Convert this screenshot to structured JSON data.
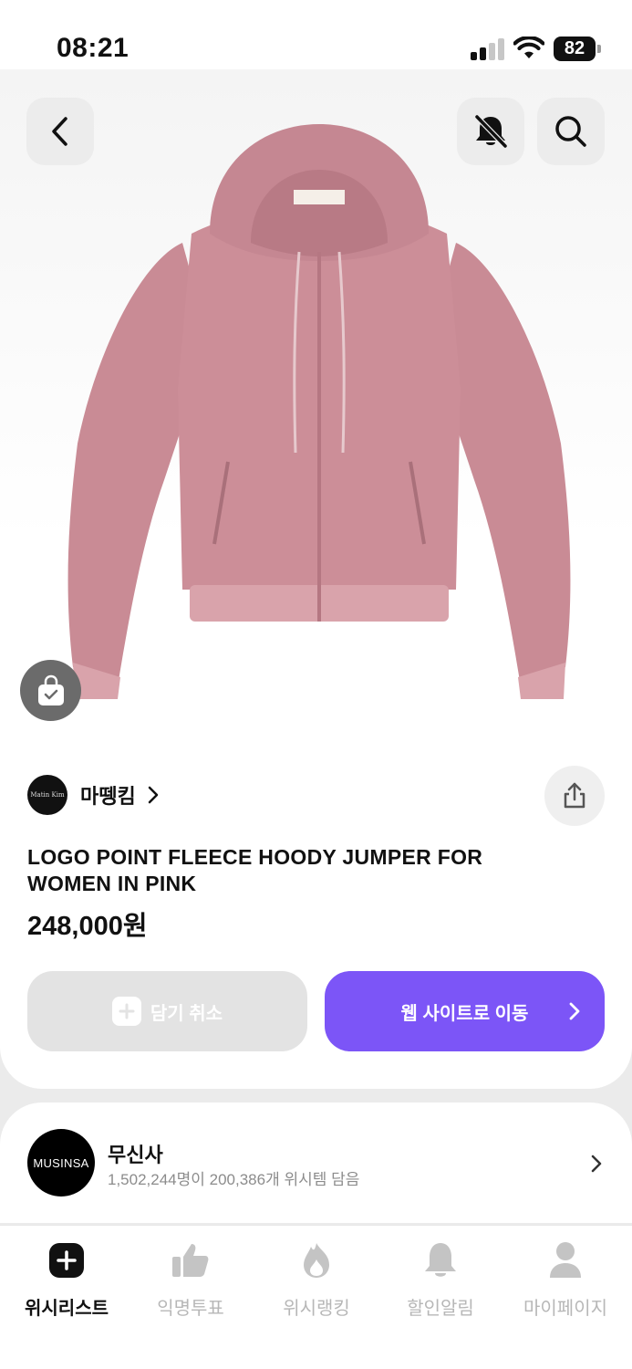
{
  "status_bar": {
    "time": "08:21",
    "battery": "82"
  },
  "product": {
    "brand_name": "마뗑킴",
    "brand_logo_text": "Matin Kim",
    "title": "LOGO POINT FLEECE HOODY JUMPER FOR WOMEN IN PINK",
    "price": "248,000원"
  },
  "actions": {
    "cancel_label": "담기 취소",
    "go_label": "웹 사이트로 이동"
  },
  "store": {
    "logo_text": "MUSINSA",
    "name": "무신사",
    "meta": "1,502,244명이 200,386개 위시템 담음"
  },
  "tabs": [
    {
      "label": "위시리스트",
      "icon": "plus-square-icon"
    },
    {
      "label": "익명투표",
      "icon": "thumbs-up-icon"
    },
    {
      "label": "위시랭킹",
      "icon": "flame-icon"
    },
    {
      "label": "할인알림",
      "icon": "bell-icon"
    },
    {
      "label": "마이페이지",
      "icon": "person-icon"
    }
  ],
  "colors": {
    "accent": "#7c55f7",
    "jacket_pink": "#c98b95"
  }
}
